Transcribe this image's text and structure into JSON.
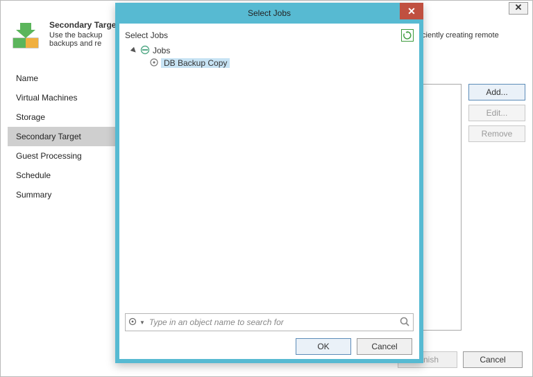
{
  "parent": {
    "heading": "Secondary Target",
    "sub_left": "Use the backup",
    "sub_right": "efficiently creating remote",
    "sub_line2": "backups and re",
    "nav": [
      "Name",
      "Virtual Machines",
      "Storage",
      "Secondary Target",
      "Guest Processing",
      "Schedule",
      "Summary"
    ],
    "selected_nav_index": 3,
    "side_buttons": {
      "add": "Add...",
      "edit": "Edit...",
      "remove": "Remove"
    },
    "footer": {
      "finish": "Finish",
      "cancel": "Cancel"
    },
    "close_glyph": "✕"
  },
  "modal": {
    "title": "Select Jobs",
    "close_glyph": "✕",
    "caption": "Select Jobs",
    "tree_root": "Jobs",
    "tree_items": [
      {
        "label": "DB Backup Copy",
        "selected": true
      }
    ],
    "search_placeholder": "Type in an object name to search for",
    "buttons": {
      "ok": "OK",
      "cancel": "Cancel"
    }
  }
}
